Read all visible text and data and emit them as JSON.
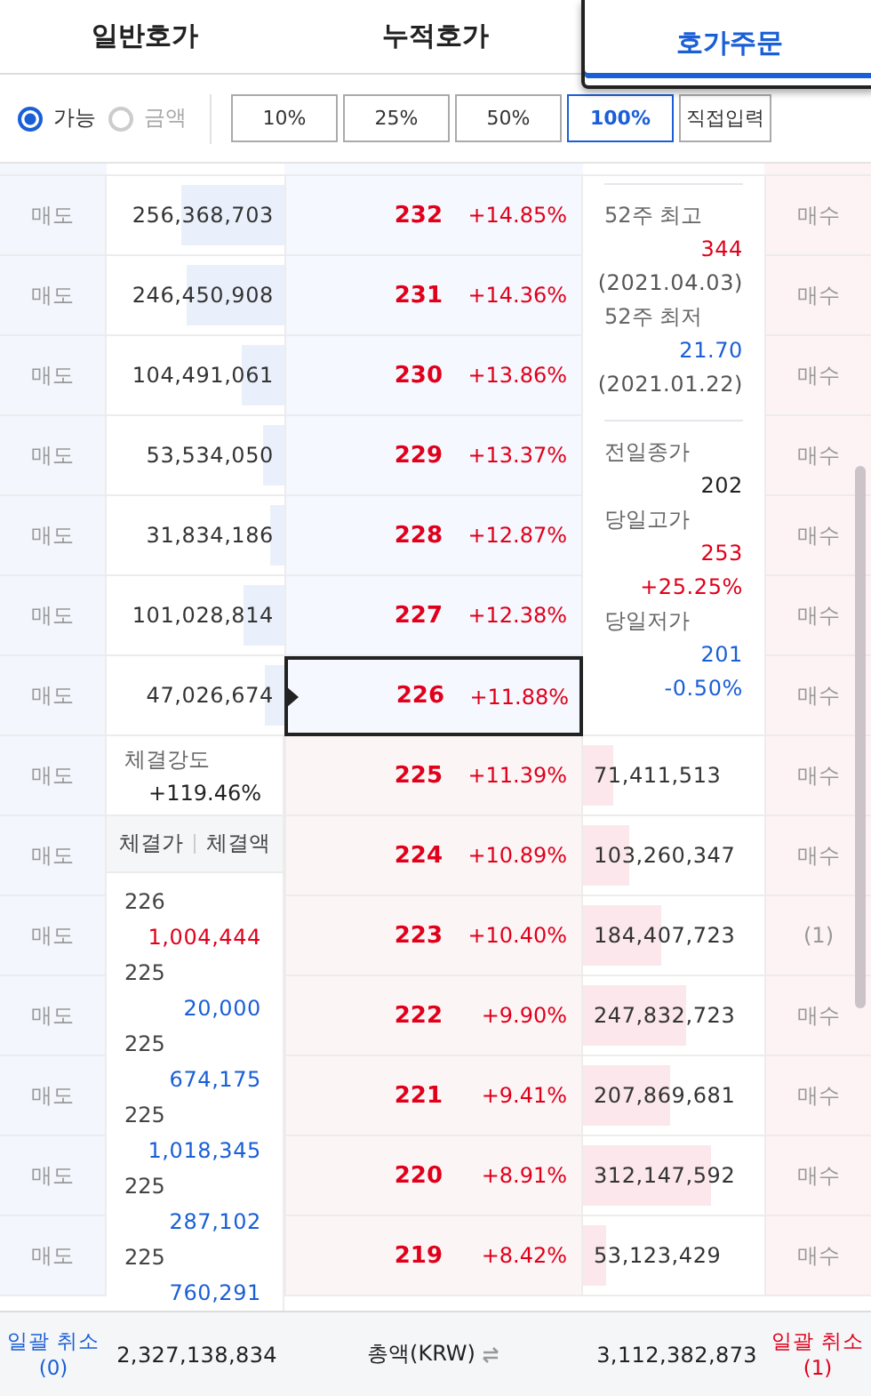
{
  "tabs": [
    {
      "label": "일반호가",
      "selected": false
    },
    {
      "label": "누적호가",
      "selected": false
    },
    {
      "label": "호가주문",
      "selected": true
    }
  ],
  "basis_options": [
    {
      "label": "가능",
      "selected": true
    },
    {
      "label": "금액",
      "selected": false
    }
  ],
  "ratio_buttons": [
    {
      "label": "10%",
      "selected": false
    },
    {
      "label": "25%",
      "selected": false
    },
    {
      "label": "50%",
      "selected": false
    },
    {
      "label": "100%",
      "selected": true
    }
  ],
  "direct_input_button": "직접입력",
  "sell_buttons": [
    "매도",
    "매도",
    "매도",
    "매도",
    "매도",
    "매도",
    "매도",
    "매도",
    "매도",
    "매도",
    "매도",
    "매도",
    "매도",
    "매도"
  ],
  "ask_volumes": [
    {
      "value": "256,368,703",
      "level": 0.58
    },
    {
      "value": "246,450,908",
      "level": 0.55
    },
    {
      "value": "104,491,061",
      "level": 0.24
    },
    {
      "value": "53,534,050",
      "level": 0.12
    },
    {
      "value": "31,834,186",
      "level": 0.08
    },
    {
      "value": "101,028,814",
      "level": 0.23
    },
    {
      "value": "47,026,674",
      "level": 0.11
    }
  ],
  "prices": [
    {
      "price": "232",
      "change": "+14.85%",
      "selected": false
    },
    {
      "price": "231",
      "change": "+14.36%",
      "selected": false
    },
    {
      "price": "230",
      "change": "+13.86%",
      "selected": false
    },
    {
      "price": "229",
      "change": "+13.37%",
      "selected": false
    },
    {
      "price": "228",
      "change": "+12.87%",
      "selected": false
    },
    {
      "price": "227",
      "change": "+12.38%",
      "selected": false
    },
    {
      "price": "226",
      "change": "+11.88%",
      "selected": true
    },
    {
      "price": "225",
      "change": "+11.39%",
      "selected": false
    },
    {
      "price": "224",
      "change": "+10.89%",
      "selected": false
    },
    {
      "price": "223",
      "change": "+10.40%",
      "selected": false
    },
    {
      "price": "222",
      "change": "+9.90%",
      "selected": false
    },
    {
      "price": "221",
      "change": "+9.41%",
      "selected": false
    },
    {
      "price": "220",
      "change": "+8.91%",
      "selected": false
    },
    {
      "price": "219",
      "change": "+8.42%",
      "selected": false
    }
  ],
  "bid_volumes": [
    {
      "value": "71,411,513",
      "level": 0.17
    },
    {
      "value": "103,260,347",
      "level": 0.25
    },
    {
      "value": "184,407,723",
      "level": 0.43
    },
    {
      "value": "247,832,723",
      "level": 0.57
    },
    {
      "value": "207,869,681",
      "level": 0.48
    },
    {
      "value": "312,147,592",
      "level": 0.71
    },
    {
      "value": "53,123,429",
      "level": 0.13
    }
  ],
  "buy_buttons": [
    "매수",
    "매수",
    "매수",
    "매수",
    "매수",
    "매수",
    "매수",
    "매수",
    "매수",
    "(1)",
    "매수",
    "매수",
    "매수",
    "매수"
  ],
  "stock_info_groups": [
    {
      "items": [
        {
          "label": "52주 최고",
          "values": [
            {
              "text": "344",
              "color": "#e0001b"
            },
            {
              "text": "(2021.04.03)",
              "color": "#555555"
            }
          ]
        },
        {
          "label": "52주 최저",
          "values": [
            {
              "text": "21.70",
              "color": "#1a5fd6"
            },
            {
              "text": "(2021.01.22)",
              "color": "#555555"
            }
          ]
        }
      ]
    },
    {
      "items": [
        {
          "label": "전일종가",
          "values": [
            {
              "text": "202",
              "color": "#222222"
            }
          ]
        },
        {
          "label": "당일고가",
          "values": [
            {
              "text": "253",
              "color": "#e0001b"
            },
            {
              "text": "+25.25%",
              "color": "#e0001b"
            }
          ]
        },
        {
          "label": "당일저가",
          "values": [
            {
              "text": "201",
              "color": "#1a5fd6"
            },
            {
              "text": "-0.50%",
              "color": "#1a5fd6"
            }
          ]
        }
      ]
    }
  ],
  "trade_strength": {
    "label": "체결강도",
    "value": "+119.46%"
  },
  "trades_header": [
    "체결가",
    "체결액"
  ],
  "trades": [
    {
      "price": "226",
      "amount": "1,004,444",
      "color": "#e0001b"
    },
    {
      "price": "225",
      "amount": "20,000",
      "color": "#1a5fd6"
    },
    {
      "price": "225",
      "amount": "674,175",
      "color": "#1a5fd6"
    },
    {
      "price": "225",
      "amount": "1,018,345",
      "color": "#1a5fd6"
    },
    {
      "price": "225",
      "amount": "287,102",
      "color": "#1a5fd6"
    },
    {
      "price": "225",
      "amount": "760,291",
      "color": "#1a5fd6"
    }
  ],
  "footer": {
    "left_cancel": {
      "label": "일괄 취소",
      "count": "(0)"
    },
    "ask_total": "2,327,138,834",
    "total_label": "총액(KRW)",
    "bid_total": "3,112,382,873",
    "right_cancel": {
      "label": "일괄 취소",
      "count": "(1)"
    }
  }
}
